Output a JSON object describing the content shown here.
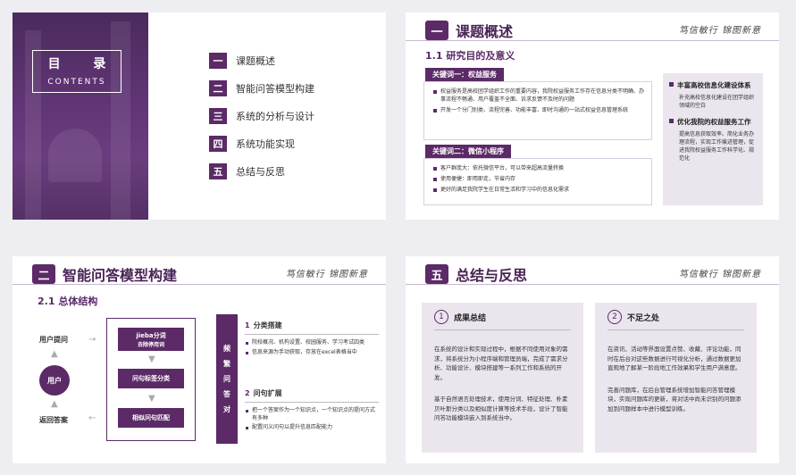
{
  "slide1": {
    "title": "目 录",
    "subtitle": "CONTENTS",
    "items": [
      {
        "num": "一",
        "label": "课题概述"
      },
      {
        "num": "二",
        "label": "智能问答模型构建"
      },
      {
        "num": "三",
        "label": "系统的分析与设计"
      },
      {
        "num": "四",
        "label": "系统功能实现"
      },
      {
        "num": "五",
        "label": "总结与反思"
      }
    ]
  },
  "slide2": {
    "num": "一",
    "title": "课题概述",
    "logo": "笃信敏行  锦图新意",
    "section": "1.1 研究目的及意义",
    "kw1": {
      "tag": "关键词一：权益服务",
      "bullets": [
        "权益服务是高校团学组织工作的重要内容，我院权益服务工作存在信息分类不明确、办事流程不畅通、用户覆盖不全面、诉求反馈不及时的问题",
        "开发一个分门别类、流程完善、功能丰富、即时沟通的一站式权益信息管理系统"
      ]
    },
    "kw2": {
      "tag": "关键词二：微信小程序",
      "bullets": [
        "客户群庞大：依托微信平台，可以带来超高流量转换",
        "使用便捷：即用即走，节省内存",
        "更好的满足我院学生在日常生活和学习中的信息化需求"
      ]
    },
    "side": [
      {
        "head": "丰富高校信息化建设体系",
        "text": "补充高校信息化建设在团学组织领域的空白"
      },
      {
        "head": "优化我院的权益服务工作",
        "text": "提高信息获取效率、简化业务办理流程，实现工作痕迹管理，促进我院权益服务工作科学化、规范化"
      }
    ]
  },
  "slide3": {
    "num": "二",
    "title": "智能问答模型构建",
    "logo": "笃信敏行  锦图新意",
    "section": "2.1 总体结构",
    "left": {
      "ask": "用户提问",
      "user": "用户",
      "answer": "返回答案"
    },
    "steps": [
      {
        "line1": "jieba分词",
        "line2": "去除停用词"
      },
      {
        "line1": "问句标签分类",
        "line2": ""
      },
      {
        "line1": "相似问句匹配",
        "line2": ""
      }
    ],
    "vbar": [
      "频",
      "繁",
      "问",
      "答",
      "对"
    ],
    "sec1": {
      "num": "1",
      "title": "分类搭建",
      "bullets": [
        "院校概况、机构设置、校园服务、学习考试四类",
        "信息来源为手动获取，存放在excel表格当中"
      ]
    },
    "sec2": {
      "num": "2",
      "title": "问句扩展",
      "bullets": [
        "把一个答案作为一个知识点，一个知识点的提问方式有多种",
        "配置问义问句以提升信息匹配能力"
      ]
    }
  },
  "slide4": {
    "num": "五",
    "title": "总结与反思",
    "logo": "笃信敏行  锦图新意",
    "cards": [
      {
        "num": "1",
        "title": "成果总结",
        "paras": [
          "在系统的设计和实现过程中，根据不同使用对象的需求，将系统分为小程序端和管理员端，完成了需求分析、功能设计、模块搭建等一系列工作和系统的开发。",
          "基于自然语言处理技术，使用分词、特征处理、朴素贝叶斯分类以及相似度计算等技术手段，设计了智能问答功能模块嵌入到系统当中。"
        ]
      },
      {
        "num": "2",
        "title": "不足之处",
        "paras": [
          "在资讯、活动等界面设置点赞、收藏、评论功能，同时在后台对这些数据进行可视化分析，通过数据更加直观地了解某一阶段地工作效果和学生用户满意度。",
          "完善问题库，在后台管理系统增加智能问答管理模块，实现问题库的更新，将对话中尚未识别的问题添加到问题样本中进行模型训练。"
        ]
      }
    ]
  }
}
